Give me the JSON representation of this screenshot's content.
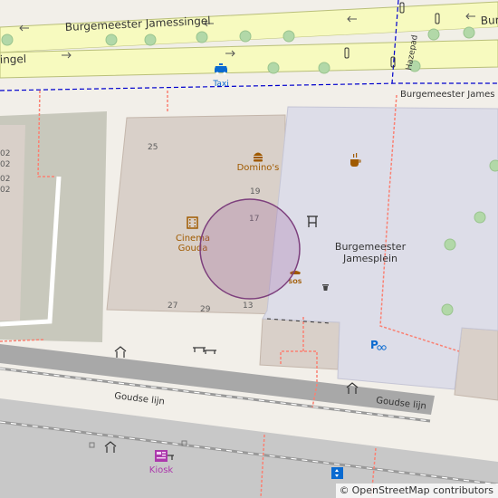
{
  "roads": {
    "main_street_top": "Burgemeester Jamessingel",
    "main_street_right": "Bur",
    "main_street_left": "ingel",
    "boundary_street": "Burgemeester James",
    "side_street": "Hazepad",
    "rail_upper": "Goudse lijn",
    "rail_lower": "Goudse lijn"
  },
  "places": {
    "square_name_line1": "Burgemeester",
    "square_name_line2": "Jamesplein",
    "cinema_line1": "Cinema",
    "cinema_line2": "Gouda",
    "restaurant": "Domino's",
    "taxi": "Taxi",
    "kiosk": "Kiosk"
  },
  "house_numbers": {
    "n25": "25",
    "n19": "19",
    "n17": "17",
    "n27": "27",
    "n29": "29",
    "n13": "13",
    "left1": "02",
    "left2": "02",
    "left3": "02",
    "left4": "02"
  },
  "icons": {
    "restaurant": "fast-food-icon",
    "cinema": "cinema-icon",
    "cafe": "cafe-icon",
    "artwork": "artwork-icon",
    "emergency_phone": "sos-icon",
    "waste_basket": "waste-basket-icon",
    "bicycle_parking": "bicycle-parking-icon",
    "taxi": "taxi-icon",
    "kiosk": "kiosk-icon",
    "elevator": "elevator-icon",
    "traffic_signal": "traffic-signal-icon",
    "bench": "bench-icon",
    "shelter": "shelter-icon"
  },
  "icon_glyphs": {
    "sos": "SOS",
    "bicycle_parking": "P"
  },
  "colors": {
    "background": "#f2efe9",
    "building": "#d9d0c9",
    "pedestrian_area": "#dddde8",
    "road_primary": "#f7fabf",
    "railway": "#b0b0b0",
    "footway": "#fa8072",
    "boundary": "#0000cd",
    "tree": "#b2d8a8",
    "poi_brown": "#a05a00",
    "poi_blue": "#0a6ad0",
    "kiosk_purple": "#ac39ac",
    "highlight": "#9b5d9b"
  },
  "attribution": {
    "copyright": "©",
    "text": "OpenStreetMap contributors"
  }
}
